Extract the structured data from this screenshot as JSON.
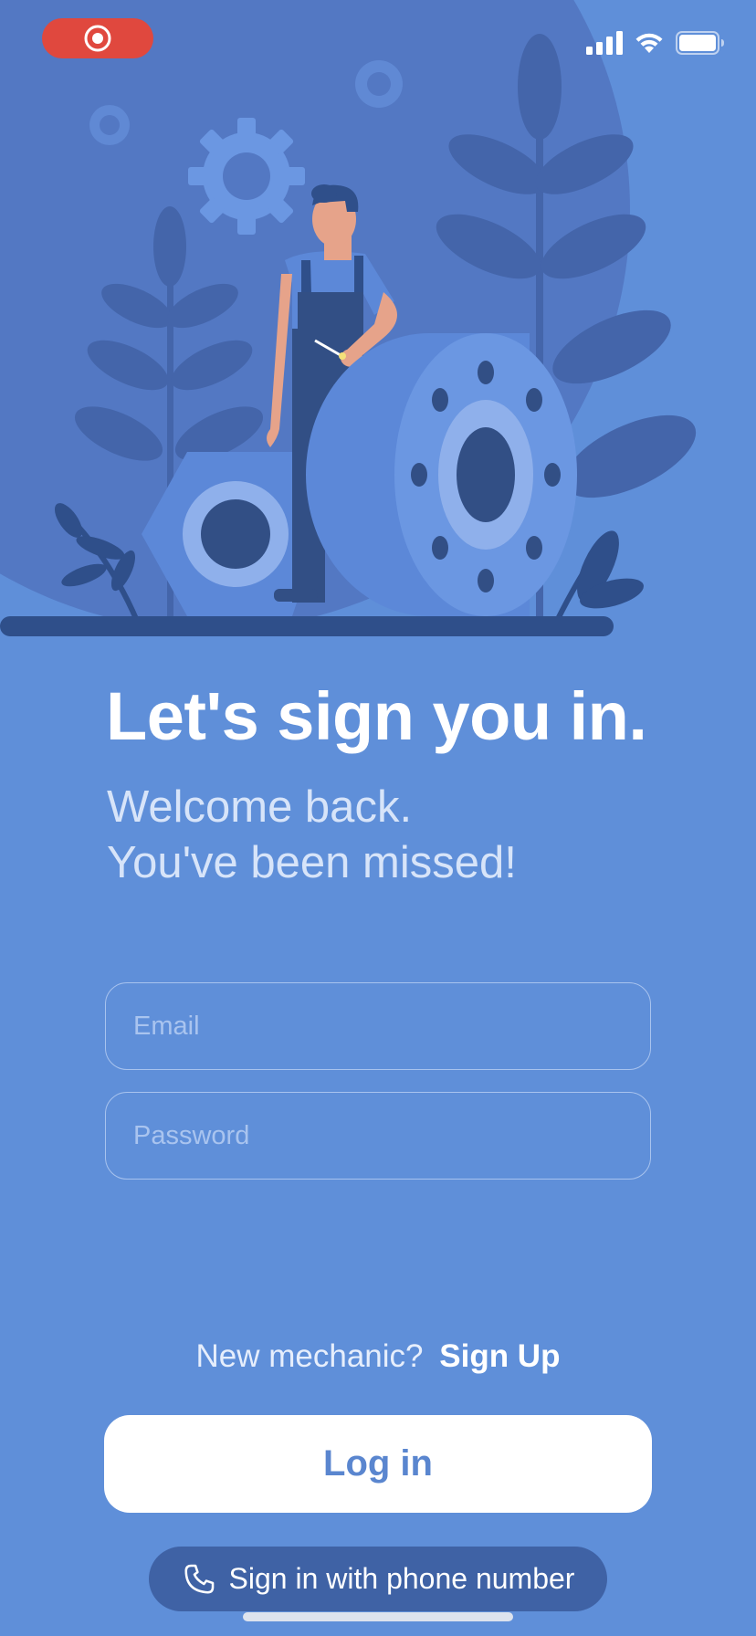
{
  "status_bar": {
    "recording_indicator": "record-icon",
    "icons": [
      "cellular-signal-icon",
      "wifi-icon",
      "battery-icon"
    ]
  },
  "hero": {
    "illustration": "mechanic-with-gears-illustration"
  },
  "header": {
    "title": "Let's sign you in.",
    "subtitle_line1": "Welcome back.",
    "subtitle_line2": "You've been missed!"
  },
  "form": {
    "email_placeholder": "Email",
    "email_value": "",
    "password_placeholder": "Password",
    "password_value": ""
  },
  "signup": {
    "prompt": "New mechanic?",
    "link_label": "Sign Up"
  },
  "actions": {
    "login_label": "Log in",
    "phone_label": "Sign in with phone number",
    "phone_icon": "phone-icon"
  },
  "colors": {
    "background": "#5f8fd9",
    "record": "#e0483e",
    "primary_text": "#5a86cf",
    "phone_button": "#3f62a5"
  }
}
